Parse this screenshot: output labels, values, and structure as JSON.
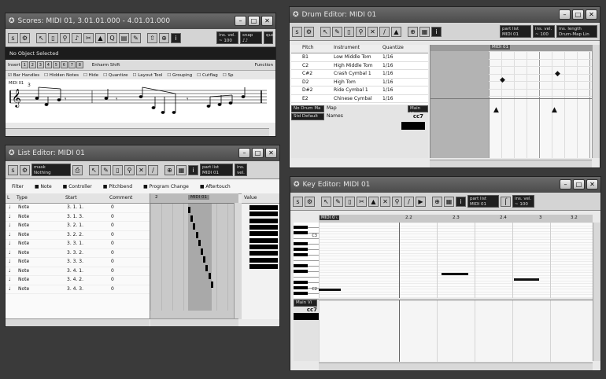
{
  "scores": {
    "title": "Scores: MIDI 01, 3.01.01.000 - 4.01.01.000",
    "status": "No Object Selected",
    "insert_label": "Insert",
    "insert_nums": [
      "1",
      "2",
      "3",
      "4",
      "5",
      "6",
      "7",
      "8"
    ],
    "enharm_label": "Enharm Shift",
    "function_label": "Function",
    "opt_bar_handles": "Bar Handles",
    "opt_hidden_notes": "Hidden Notes",
    "opt_hide": "Hide",
    "opt_quantize": "Quantize",
    "opt_layout_tool": "Layout Tool",
    "opt_grouping": "Grouping",
    "opt_cutflag": "Cutflag",
    "opt_split": "Sp",
    "ins_vel_label": "ins. vel.",
    "ins_vel_val": "~ 100 ~",
    "snap_label": "snap",
    "quant_label": "quant",
    "staff_label": "MIDI 01",
    "measure_num": "3"
  },
  "list_editor": {
    "title": "List Editor: MIDI 01",
    "mask_label": "mask",
    "mask_value": "Nothing",
    "part_list_label": "part list",
    "part_list_value": "MIDI 01",
    "ins_vel_label": "ins. vel.",
    "filter_label": "Filter",
    "filters": [
      "Note",
      "Controller",
      "Pitchbend",
      "Program Change",
      "Aftertouch"
    ],
    "col_l": "L",
    "col_type": "Type",
    "col_start": "Start",
    "col_comment": "Comment",
    "col_value": "Value",
    "ruler_label": "2",
    "ruler_part": "MIDI 01",
    "events": [
      {
        "type": "Note",
        "start": "3. 1. 1.",
        "c": "0"
      },
      {
        "type": "Note",
        "start": "3. 1. 3.",
        "c": "0"
      },
      {
        "type": "Note",
        "start": "3. 2. 1.",
        "c": "0"
      },
      {
        "type": "Note",
        "start": "3. 2. 2.",
        "c": "0"
      },
      {
        "type": "Note",
        "start": "3. 3. 1.",
        "c": "0"
      },
      {
        "type": "Note",
        "start": "3. 3. 2.",
        "c": "0"
      },
      {
        "type": "Note",
        "start": "3. 3. 3.",
        "c": "0"
      },
      {
        "type": "Note",
        "start": "3. 4. 1.",
        "c": "0"
      },
      {
        "type": "Note",
        "start": "3. 4. 2.",
        "c": "0"
      },
      {
        "type": "Note",
        "start": "3. 4. 3.",
        "c": "0"
      }
    ]
  },
  "drum_editor": {
    "title": "Drum Editor: MIDI 01",
    "part_list_label": "part list",
    "part_list_value": "MIDI 01",
    "ins_vel_label": "ins. vel.",
    "ins_vel_val": "~ 100 ~",
    "ins_length_label": "ins. length",
    "ins_length_val": "Drum-Map Lin",
    "col_pitch": "Pitch",
    "col_instrument": "Instrument",
    "col_quantize": "Quantize",
    "rows": [
      {
        "pitch": "B1",
        "inst": "Low Middle Tom",
        "q": "1/16"
      },
      {
        "pitch": "C2",
        "inst": "High Middle Tom",
        "q": "1/16"
      },
      {
        "pitch": "C#2",
        "inst": "Crash Cymbal 1",
        "q": "1/16"
      },
      {
        "pitch": "D2",
        "inst": "High Tom",
        "q": "1/16"
      },
      {
        "pitch": "D#2",
        "inst": "Ride Cymbal 1",
        "q": "1/16"
      },
      {
        "pitch": "E2",
        "inst": "Chinese Cymbal",
        "q": "1/16"
      }
    ],
    "no_drum_map": "No Drum Ma",
    "map_label": "Map",
    "std_default": "Std Default",
    "names_label": "Names",
    "main_vi": "Main Vi",
    "cc7": "cc7",
    "ruler_part": "MIDI 01"
  },
  "key_editor": {
    "title": "Key Editor: MIDI 01",
    "part_list_label": "part list",
    "part_list_value": "MIDI 01",
    "ins_vel_label": "ins. vel.",
    "ins_vel_val": "~ 100 ~",
    "ruler_part": "MIDI 01",
    "ruler_nums": [
      "2",
      "2.2",
      "2.3",
      "2.4",
      "3",
      "3.2"
    ],
    "c3": "C3",
    "c2": "C2",
    "main_vi": "Main Vi",
    "cc7": "cc7"
  }
}
